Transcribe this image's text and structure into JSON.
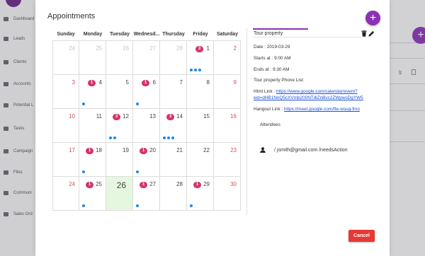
{
  "background": {
    "nav": [
      {
        "label": "Dashboard",
        "icon": "grid-icon"
      },
      {
        "label": "Leads",
        "icon": "list-icon"
      },
      {
        "label": "Clients",
        "icon": "people-icon"
      },
      {
        "label": "Accounts",
        "icon": "account-icon"
      },
      {
        "label": "Potential L",
        "icon": "target-icon"
      },
      {
        "label": "Tasks",
        "icon": "tasks-icon"
      },
      {
        "label": "Campaign",
        "icon": "campaign-icon"
      },
      {
        "label": "Files",
        "icon": "folder-icon"
      },
      {
        "label": "Communi",
        "icon": "chat-icon"
      },
      {
        "label": "Sales Ord",
        "icon": "cart-icon"
      }
    ]
  },
  "modal": {
    "title": "Appointments",
    "add_button": "+",
    "cancel_label": "Cancel",
    "colors": {
      "accent": "#8b31b3",
      "badge": "#d6336c",
      "dot": "#1e88e5",
      "cancel": "#e53935",
      "today": "#e6f7df"
    }
  },
  "calendar": {
    "weekdays": [
      "Sunday",
      "Monday",
      "Tuesday",
      "Wednesd...",
      "Thursday",
      "Friday",
      "Saturday"
    ],
    "today": "26",
    "weeks": [
      [
        {
          "day": "24",
          "other": true
        },
        {
          "day": "25",
          "other": true
        },
        {
          "day": "26",
          "other": true
        },
        {
          "day": "27",
          "other": true
        },
        {
          "day": "28",
          "other": true
        },
        {
          "day": "1",
          "badge": "3",
          "dots": 3
        },
        {
          "day": "2"
        }
      ],
      [
        {
          "day": "3"
        },
        {
          "day": "4",
          "badge": "1",
          "dots": 1
        },
        {
          "day": "5"
        },
        {
          "day": "6",
          "badge": "1",
          "dots": 1
        },
        {
          "day": "7"
        },
        {
          "day": "8"
        },
        {
          "day": "9"
        }
      ],
      [
        {
          "day": "10"
        },
        {
          "day": "11"
        },
        {
          "day": "12",
          "badge": "3",
          "dots": 2
        },
        {
          "day": "13"
        },
        {
          "day": "14",
          "badge": "3",
          "dots": 3
        },
        {
          "day": "15"
        },
        {
          "day": "16"
        }
      ],
      [
        {
          "day": "17"
        },
        {
          "day": "18",
          "badge": "1",
          "dots": 1
        },
        {
          "day": "19"
        },
        {
          "day": "20",
          "badge": "1",
          "dots": 1
        },
        {
          "day": "21"
        },
        {
          "day": "22"
        },
        {
          "day": "23"
        }
      ],
      [
        {
          "day": "24"
        },
        {
          "day": "25",
          "badge": "1",
          "dots": 1
        },
        {
          "day": "26",
          "today": true
        },
        {
          "day": "27",
          "badge": "1",
          "dots": 1
        },
        {
          "day": "28"
        },
        {
          "day": "29",
          "badge": "1",
          "dots": 1
        },
        {
          "day": "30"
        }
      ]
    ]
  },
  "detail": {
    "title": "Tour property",
    "date": "Date : 2019-03-29",
    "starts": "Starts at : 9:00 AM",
    "ends": "Ends at : 9:30 AM",
    "phone_list": "Tour property Phone List:",
    "html_link_label": "Html Link : ",
    "html_link_line1": "https://www.google.com/calendar/event?",
    "html_link_line2": "eid=dHB1NnQ5cXVmb200NTdlZnBvc2ZWpwsDgYW5",
    "hangout_label": "Hangout Link : ",
    "hangout_link": "https://meet.google.com/fte-wsug-fmo",
    "attendees_label": "Attendees",
    "attendee": "/ jsmith@gmail.com /needsAction"
  }
}
